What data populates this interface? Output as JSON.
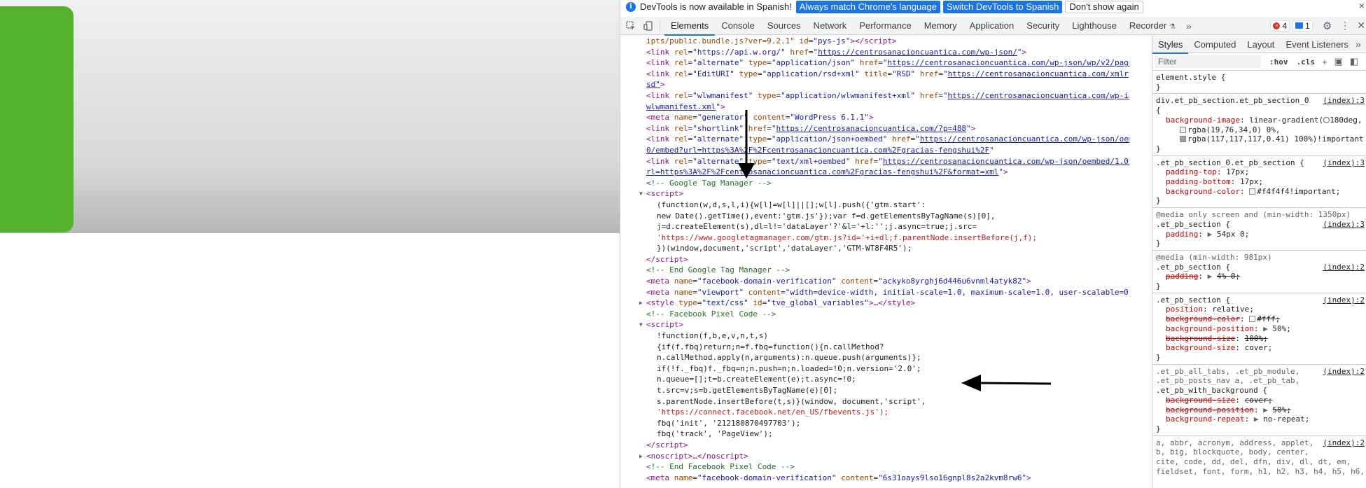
{
  "infobar": {
    "message": "DevTools is now available in Spanish!",
    "match_button": "Always match Chrome's language",
    "switch_button": "Switch DevTools to Spanish",
    "dismiss_button": "Don't show again",
    "close": "×"
  },
  "tabs": [
    "Elements",
    "Console",
    "Sources",
    "Network",
    "Performance",
    "Memory",
    "Application",
    "Security",
    "Lighthouse",
    "Recorder"
  ],
  "tabs_more": "»",
  "counts": {
    "errors": "4",
    "messages": "1"
  },
  "subtabs": [
    "Styles",
    "Computed",
    "Layout",
    "Event Listeners"
  ],
  "subtabs_more": "»",
  "filter": {
    "placeholder": "Filter",
    "hov": ":hov",
    "cls": ".cls",
    "add": "+"
  },
  "code": {
    "l1_text": "ipts/public.bundle.js?ver=9.2.1\"",
    "l1_id_val": "\"pys-js\"",
    "l2_href": "https://api.w.org/",
    "l2_href2": "https://centrosanacioncuantica.com/wp-json/",
    "l3_href": "https://centrosanacioncuantica.com/wp-json/wp/v2/pages/48",
    "l4_title": "\"RSD\"",
    "l4_href": "https://centrosanacioncuantica.com/xmlrpc.ph",
    "l4b": "sd\"",
    "l5_href": "https://centrosanacioncuantica.com/wp-includ",
    "l5b": "wlwmanifest.xml",
    "l6_content": "\"WordPress 6.1.1\"",
    "l7_href": "https://centrosanacioncuantica.com/?p=488",
    "l8_href": "https://centrosanacioncuantica.com/wp-json/oembed/",
    "l8b": "0/embed?url=https%3A%2F%2Fcentrosanacioncuantica.com%2Fgracias-fengshui%2F",
    "l9_href": "https://centrosanacioncuantica.com/wp-json/oembed/1.0/embe",
    "l9b": "rl=https%3A%2F%2Fcentrosanacioncuantica.com%2Fgracias-fengshui%2F&format=xml",
    "gtm_comment": "<!-- Google Tag Manager -->",
    "gtm1": "(function(w,d,s,l,i){w[l]=w[l]||[];w[l].push({'gtm.start':",
    "gtm2": "new Date().getTime(),event:'gtm.js'});var f=d.getElementsByTagName(s)[0],",
    "gtm3": "j=d.createElement(s),dl=l!='dataLayer'?'&l='+l:'';j.async=true;j.src=",
    "gtm4": "'https://www.googletagmanager.com/gtm.js?id='+i+dl;f.parentNode.insertBefore(j,f);",
    "gtm5": "})(window,document,'script','dataLayer','GTM-WT8F4R5');",
    "gtm_end": "<!-- End Google Tag Manager -->",
    "fb_verif": "\"ackyko8yrghj6d446u6vnml4atyk82\"",
    "viewport": "\"width=device-width, initial-scale=1.0, maximum-scale=1.0, user-scalable=0\"",
    "style_id": "\"tve_global_variables\"",
    "fb_comment": "<!-- Facebook Pixel Code -->",
    "fb1": "!function(f,b,e,v,n,t,s)",
    "fb2": "{if(f.fbq)return;n=f.fbq=function(){n.callMethod?",
    "fb3": "n.callMethod.apply(n,arguments):n.queue.push(arguments)};",
    "fb4": "if(!f._fbq)f._fbq=n;n.push=n;n.loaded=!0;n.version='2.0';",
    "fb5": "n.queue=[];t=b.createElement(e);t.async=!0;",
    "fb6": "t.src=v;s=b.getElementsByTagName(e)[0];",
    "fb7": "s.parentNode.insertBefore(t,s)}(window, document,'script',",
    "fb8": "'https://connect.facebook.net/en_US/fbevents.js');",
    "fb9": "fbq('init', '212180870497703');",
    "fb10": "fbq('track', 'PageView');",
    "noscript": "<noscript>…</noscript>",
    "fb_end": "<!-- End Facebook Pixel Code -->",
    "fb_verif2": "\"6s31oays9lso16gnpl8s2a2kvm8rw6\""
  },
  "styles": {
    "element_style": "element.style {",
    "r1_sel": "div.et_pb_section.et_pb_section_0",
    "r1_src": "(index):3",
    "r1_prop": "background-image",
    "r1_v1": "linear-gradient(",
    "r1_v1b": "180deg,",
    "r1_v2": "rgba(19,76,34,0) 0%,",
    "r1_v3": "rgba(117,117,117,0.41) 100%)!important",
    "r2_sel": ".et_pb_section_0.et_pb_section {",
    "r2_src": "(index):3",
    "r2_d1p": "padding-top",
    "r2_d1v": "17px;",
    "r2_d2p": "padding-bottom",
    "r2_d2v": "17px;",
    "r2_d3p": "background-color",
    "r2_d3v": "#f4f4f4!important;",
    "r3_media": "@media only screen and (min-width: 1350px)",
    "r3_sel": ".et_pb_section {",
    "r3_src": "(index):3",
    "r3_d1p": "padding",
    "r3_d1v": "54px 0;",
    "r4_media": "@media (min-width: 981px)",
    "r4_sel": ".et_pb_section {",
    "r4_src": "(index):2",
    "r4_d1p": "padding",
    "r4_d1v": "4% 0;",
    "r5_sel": ".et_pb_section {",
    "r5_src": "(index):2",
    "r5_d1p": "position",
    "r5_d1v": "relative;",
    "r5_d2p": "background-color",
    "r5_d2v": "#fff;",
    "r5_d3p": "background-position",
    "r5_d3v": "50%;",
    "r5_d4p": "background-size",
    "r5_d4v": "100%;",
    "r5_d5p": "background-size",
    "r5_d5v": "cover;",
    "r6_sel1": ".et_pb_all_tabs, .et_pb_module,",
    "r6_sel2": ".et_pb_posts_nav a, .et_pb_tab,",
    "r6_sel3": ".et_pb_with_background {",
    "r6_src": "(index):2",
    "r6_d1p": "background-size",
    "r6_d1v": "cover;",
    "r6_d2p": "background-position",
    "r6_d2v": "50%;",
    "r6_d3p": "background-repeat",
    "r6_d3v": "no-repeat;",
    "r7_sel1": "a, abbr, acronym, address, applet,",
    "r7_sel2": "b, big, blockquote, body, center,",
    "r7_sel3": "cite, code, dd, del, dfn, div, dl, dt, em,",
    "r7_sel4": "fieldset, font, form, h1, h2, h3, h4, h5, h6,",
    "r7_src": "(index):2"
  }
}
